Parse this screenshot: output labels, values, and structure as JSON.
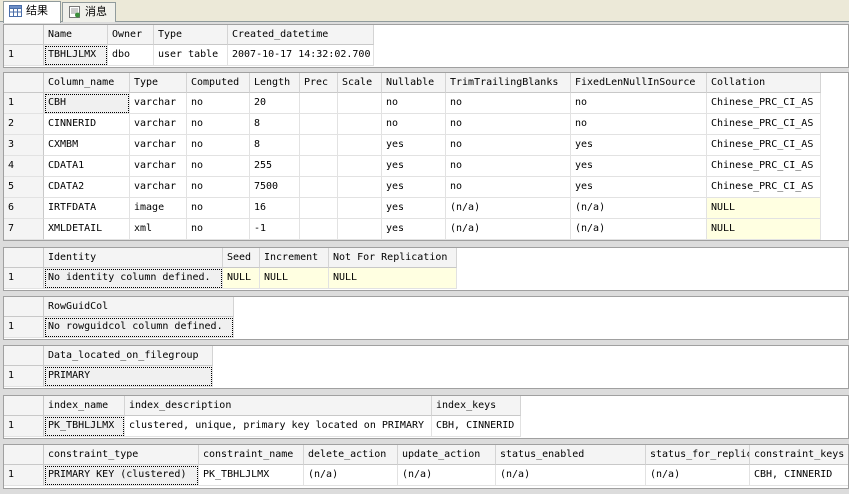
{
  "tabs": [
    {
      "label": "结果",
      "icon": "grid-icon",
      "active": true
    },
    {
      "label": "消息",
      "icon": "message-icon",
      "active": false
    }
  ],
  "grids": [
    {
      "name": "table-info-grid",
      "columns": [
        "Name",
        "Owner",
        "Type",
        "Created_datetime"
      ],
      "rows": [
        [
          "1",
          "TBHLJLMX",
          "dbo",
          "user table",
          "2007-10-17 14:32:02.700"
        ]
      ]
    },
    {
      "name": "columns-grid",
      "columns": [
        "Column_name",
        "Type",
        "Computed",
        "Length",
        "Prec",
        "Scale",
        "Nullable",
        "TrimTrailingBlanks",
        "FixedLenNullInSource",
        "Collation"
      ],
      "rows": [
        [
          "1",
          "CBH",
          "varchar",
          "no",
          "20",
          "",
          "",
          "no",
          "no",
          "no",
          "Chinese_PRC_CI_AS"
        ],
        [
          "2",
          "CINNERID",
          "varchar",
          "no",
          "8",
          "",
          "",
          "no",
          "no",
          "no",
          "Chinese_PRC_CI_AS"
        ],
        [
          "3",
          "CXMBM",
          "varchar",
          "no",
          "8",
          "",
          "",
          "yes",
          "no",
          "yes",
          "Chinese_PRC_CI_AS"
        ],
        [
          "4",
          "CDATA1",
          "varchar",
          "no",
          "255",
          "",
          "",
          "yes",
          "no",
          "yes",
          "Chinese_PRC_CI_AS"
        ],
        [
          "5",
          "CDATA2",
          "varchar",
          "no",
          "7500",
          "",
          "",
          "yes",
          "no",
          "yes",
          "Chinese_PRC_CI_AS"
        ],
        [
          "6",
          "IRTFDATA",
          "image",
          "no",
          "16",
          "",
          "",
          "yes",
          "(n/a)",
          "(n/a)",
          "NULL"
        ],
        [
          "7",
          "XMLDETAIL",
          "xml",
          "no",
          "-1",
          "",
          "",
          "yes",
          "(n/a)",
          "(n/a)",
          "NULL"
        ]
      ]
    },
    {
      "name": "identity-grid",
      "columns": [
        "Identity",
        "Seed",
        "Increment",
        "Not For Replication"
      ],
      "rows": [
        [
          "1",
          "No identity column defined.",
          "NULL",
          "NULL",
          "NULL"
        ]
      ]
    },
    {
      "name": "rowguidcol-grid",
      "columns": [
        "RowGuidCol"
      ],
      "rows": [
        [
          "1",
          "No rowguidcol column defined."
        ]
      ]
    },
    {
      "name": "filegroup-grid",
      "columns": [
        "Data_located_on_filegroup"
      ],
      "rows": [
        [
          "1",
          "PRIMARY"
        ]
      ]
    },
    {
      "name": "index-grid",
      "columns": [
        "index_name",
        "index_description",
        "index_keys"
      ],
      "rows": [
        [
          "1",
          "PK_TBHLJLMX",
          "clustered, unique, primary key located on PRIMARY",
          "CBH, CINNERID"
        ]
      ]
    },
    {
      "name": "constraints-grid",
      "columns": [
        "constraint_type",
        "constraint_name",
        "delete_action",
        "update_action",
        "status_enabled",
        "status_for_replication",
        "constraint_keys"
      ],
      "rows": [
        [
          "1",
          "PRIMARY KEY (clustered)",
          "PK_TBHLJLMX",
          "(n/a)",
          "(n/a)",
          "(n/a)",
          "(n/a)",
          "CBH, CINNERID"
        ]
      ]
    }
  ],
  "colors": {
    "null_cell_bg": "#ffffe1",
    "header_bg": "#f4f4f4",
    "pane_separator": "#dcdcdc"
  }
}
